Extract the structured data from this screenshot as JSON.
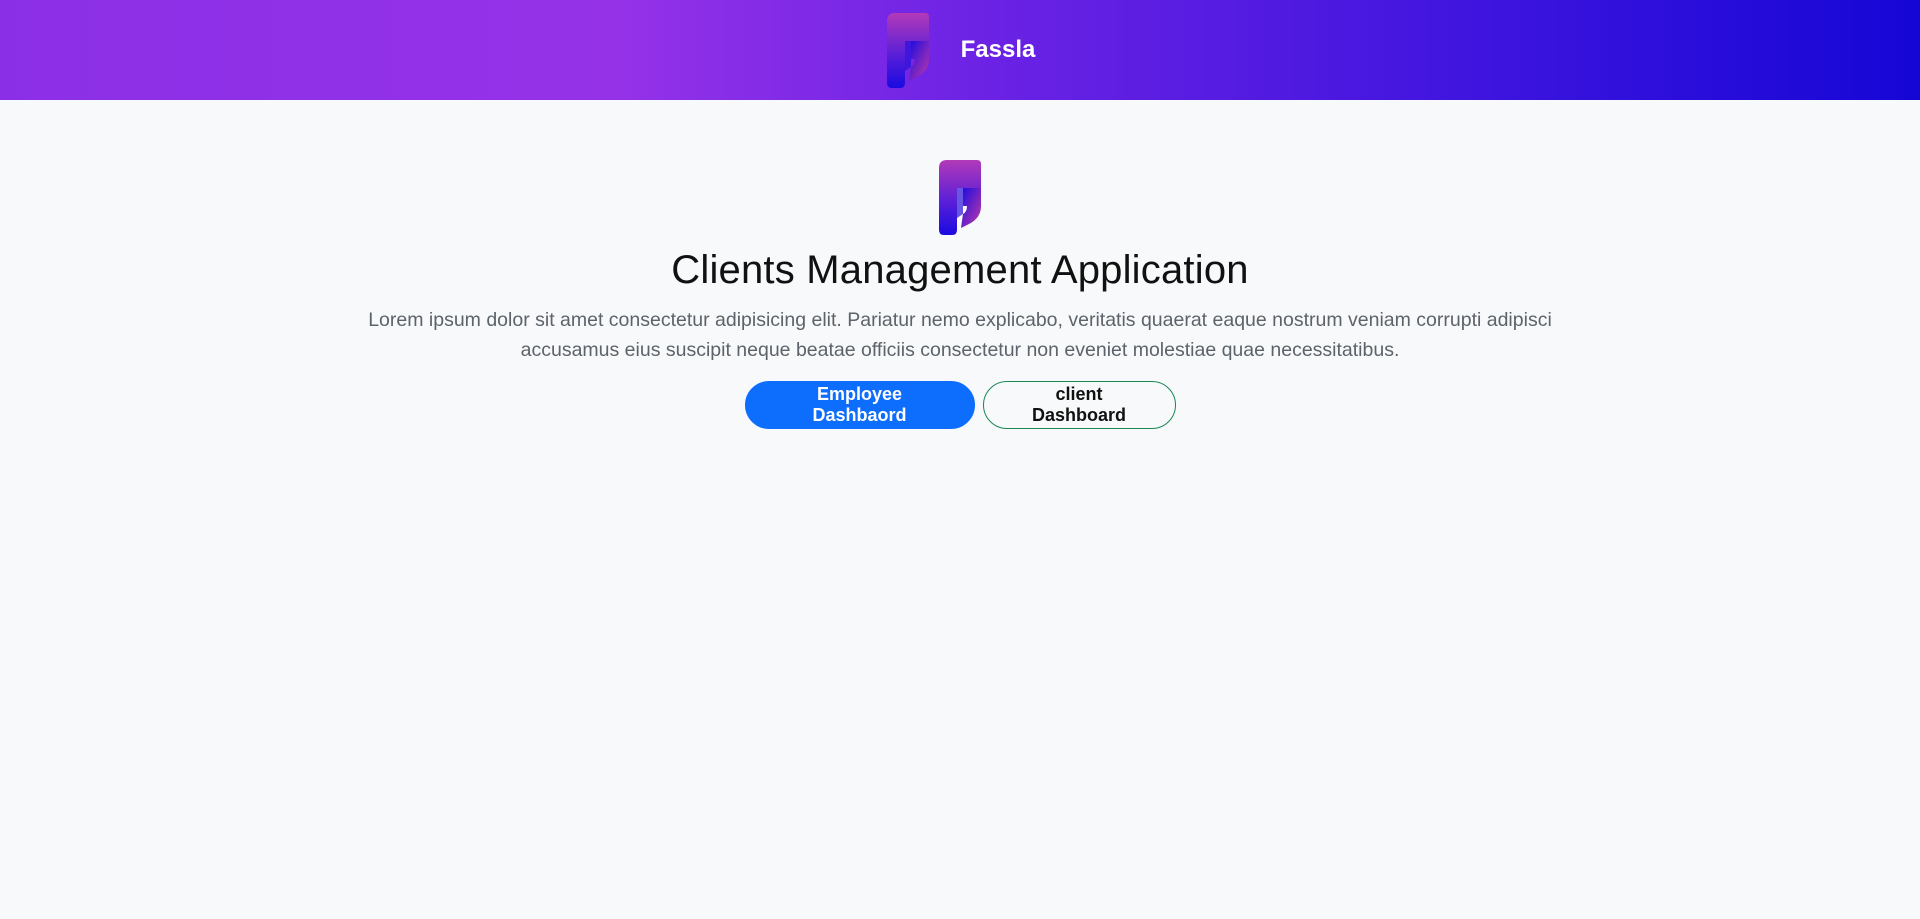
{
  "navbar": {
    "brand_name": "Fassla"
  },
  "hero": {
    "title": "Clients Management Application",
    "description": "Lorem ipsum dolor sit amet consectetur adipisicing elit. Pariatur nemo explicabo, veritatis quaerat eaque nostrum veniam corrupti adipisci accusamus eius suscipit neque beatae officiis consectetur non eveniet molestiae quae necessitatibus.",
    "primary_button": "Employee Dashbaord",
    "secondary_button": "client Dashboard"
  },
  "icons": {
    "brand_logo": "fassla-logo-icon"
  },
  "colors": {
    "primary": "#0d6efd",
    "success_outline": "#198754",
    "navbar_gradient_start": "#9532e8",
    "navbar_gradient_end": "#1506d6"
  }
}
